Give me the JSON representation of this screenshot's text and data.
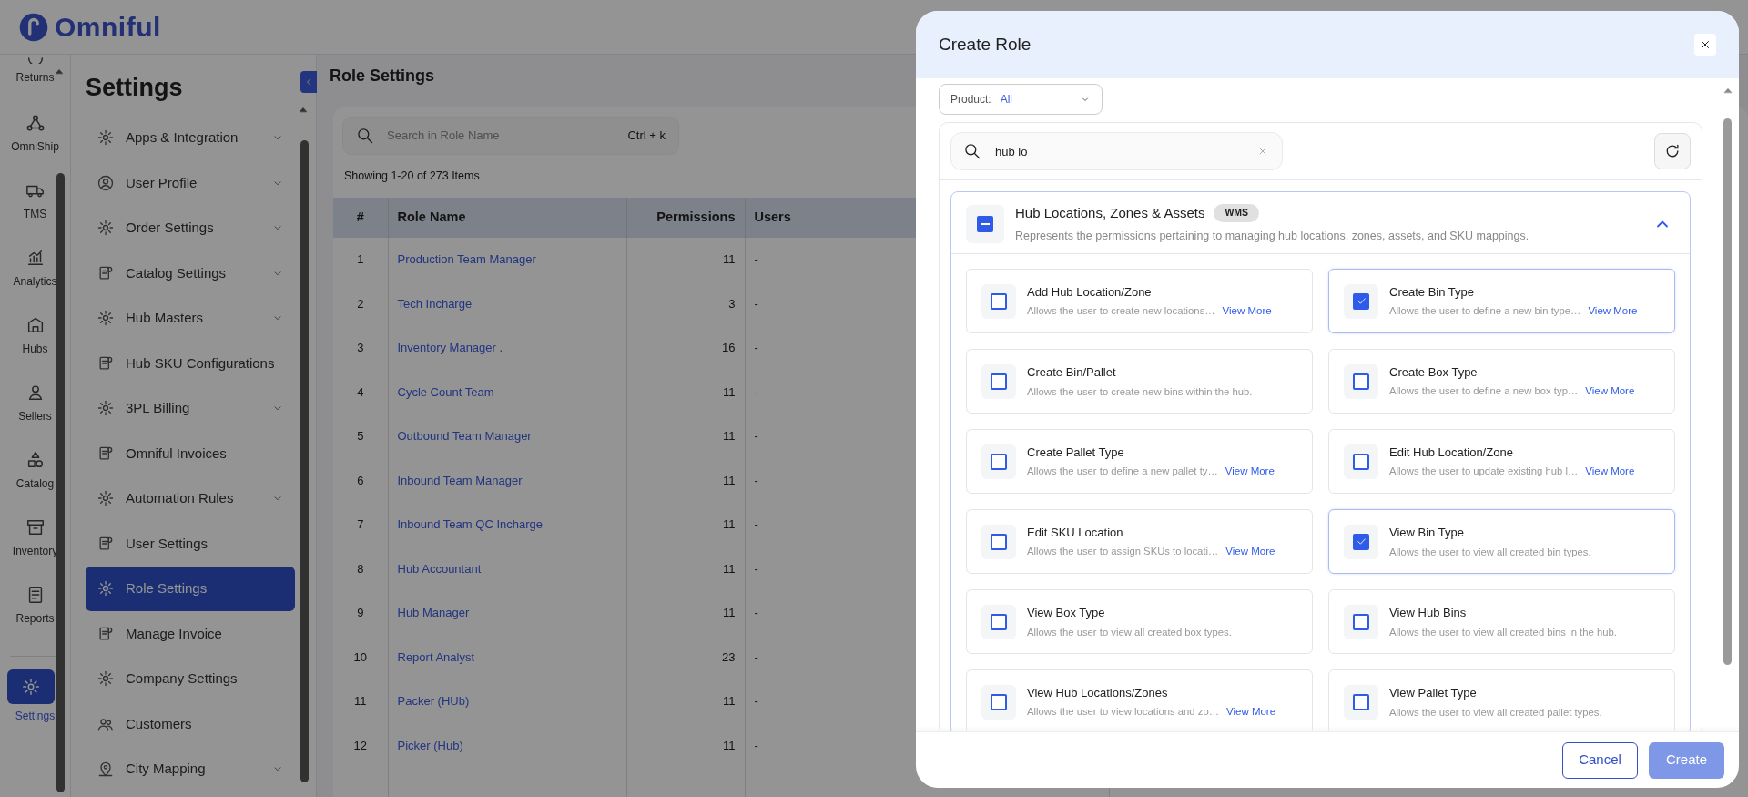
{
  "app": {
    "logo": "Omniful"
  },
  "rail": {
    "items": [
      {
        "label": "Returns",
        "selected": false
      },
      {
        "label": "OmniShip",
        "selected": false
      },
      {
        "label": "TMS",
        "selected": false
      },
      {
        "label": "Analytics",
        "selected": false
      },
      {
        "label": "Hubs",
        "selected": false
      },
      {
        "label": "Sellers",
        "selected": false
      },
      {
        "label": "Catalog",
        "selected": false
      },
      {
        "label": "Inventory",
        "selected": false
      },
      {
        "label": "Reports",
        "selected": false
      },
      {
        "label": "Settings",
        "selected": true
      }
    ]
  },
  "settings_menu": {
    "title": "Settings",
    "items": [
      {
        "label": "Apps & Integration",
        "expandable": true,
        "selected": false
      },
      {
        "label": "User Profile",
        "expandable": true,
        "selected": false
      },
      {
        "label": "Order Settings",
        "expandable": true,
        "selected": false
      },
      {
        "label": "Catalog Settings",
        "expandable": true,
        "selected": false
      },
      {
        "label": "Hub Masters",
        "expandable": true,
        "selected": false
      },
      {
        "label": "Hub SKU Configurations",
        "expandable": false,
        "selected": false
      },
      {
        "label": "3PL Billing",
        "expandable": true,
        "selected": false
      },
      {
        "label": "Omniful Invoices",
        "expandable": false,
        "selected": false
      },
      {
        "label": "Automation Rules",
        "expandable": true,
        "selected": false
      },
      {
        "label": "User Settings",
        "expandable": false,
        "selected": false
      },
      {
        "label": "Role Settings",
        "expandable": false,
        "selected": true
      },
      {
        "label": "Manage Invoice",
        "expandable": false,
        "selected": false
      },
      {
        "label": "Company Settings",
        "expandable": false,
        "selected": false
      },
      {
        "label": "Customers",
        "expandable": false,
        "selected": false
      },
      {
        "label": "City Mapping",
        "expandable": true,
        "selected": false
      }
    ]
  },
  "page": {
    "title": "Role Settings",
    "search": {
      "placeholder": "Search in Role Name",
      "shortcut": "Ctrl + k"
    },
    "summary": "Showing 1-20 of 273 Items",
    "table": {
      "columns": [
        "#",
        "Role Name",
        "Permissions",
        "Users"
      ],
      "rows": [
        {
          "cells": [
            "1",
            "Production Team Manager",
            "11",
            "-"
          ]
        },
        {
          "cells": [
            "2",
            "Tech Incharge",
            "3",
            "-"
          ]
        },
        {
          "cells": [
            "3",
            "Inventory Manager .",
            "16",
            "-"
          ]
        },
        {
          "cells": [
            "4",
            "Cycle Count Team",
            "11",
            "-"
          ]
        },
        {
          "cells": [
            "5",
            "Outbound Team Manager",
            "11",
            "-"
          ]
        },
        {
          "cells": [
            "6",
            "Inbound Team Manager",
            "11",
            "-"
          ]
        },
        {
          "cells": [
            "7",
            "Inbound Team QC Incharge",
            "11",
            "-"
          ]
        },
        {
          "cells": [
            "8",
            "Hub Accountant",
            "11",
            "-"
          ]
        },
        {
          "cells": [
            "9",
            "Hub Manager",
            "11",
            "-"
          ]
        },
        {
          "cells": [
            "10",
            "Report Analyst",
            "23",
            "-"
          ]
        },
        {
          "cells": [
            "11",
            "Packer (HUb)",
            "11",
            "-"
          ]
        },
        {
          "cells": [
            "12",
            "Picker (Hub)",
            "11",
            "-"
          ]
        }
      ]
    }
  },
  "modal": {
    "title": "Create Role",
    "product_filter": {
      "label": "Product:",
      "value": "All"
    },
    "search": {
      "value": "hub lo"
    },
    "group": {
      "title": "Hub Locations, Zones & Assets",
      "tag": "WMS",
      "description": "Represents the permissions pertaining to managing hub locations, zones, assets, and SKU mappings.",
      "indeterminate": true,
      "expanded": true,
      "permissions": [
        {
          "name": "Add Hub Location/Zone",
          "description": "Allows the user to create new locations…",
          "link": "View More",
          "checked": false
        },
        {
          "name": "Create Bin Type",
          "description": "Allows the user to define a new bin type…",
          "link": "View More",
          "checked": true
        },
        {
          "name": "Create Bin/Pallet",
          "description": "Allows the user to create new bins within the hub.",
          "checked": false
        },
        {
          "name": "Create Box Type",
          "description": "Allows the user to define a new box typ…",
          "link": "View More",
          "checked": false
        },
        {
          "name": "Create Pallet Type",
          "description": "Allows the user to define a new pallet ty…",
          "link": "View More",
          "checked": false
        },
        {
          "name": "Edit Hub Location/Zone",
          "description": "Allows the user to update existing hub l…",
          "link": "View More",
          "checked": false
        },
        {
          "name": "Edit SKU Location",
          "description": "Allows the user to assign SKUs to locati…",
          "link": "View More",
          "checked": false
        },
        {
          "name": "View Bin Type",
          "description": "Allows the user to view all created bin types.",
          "checked": true
        },
        {
          "name": "View Box Type",
          "description": "Allows the user to view all created box types.",
          "checked": false
        },
        {
          "name": "View Hub Bins",
          "description": "Allows the user to view all created bins in the hub.",
          "checked": false
        },
        {
          "name": "View Hub Locations/Zones",
          "description": "Allows the user to view locations and zo…",
          "link": "View More",
          "checked": false
        },
        {
          "name": "View Pallet Type",
          "description": "Allows the user to view all created pallet types.",
          "checked": false
        }
      ]
    },
    "buttons": [
      {
        "label": "Cancel",
        "kind": "outline"
      },
      {
        "label": "Create",
        "kind": "primary",
        "disabled": true
      }
    ]
  }
}
